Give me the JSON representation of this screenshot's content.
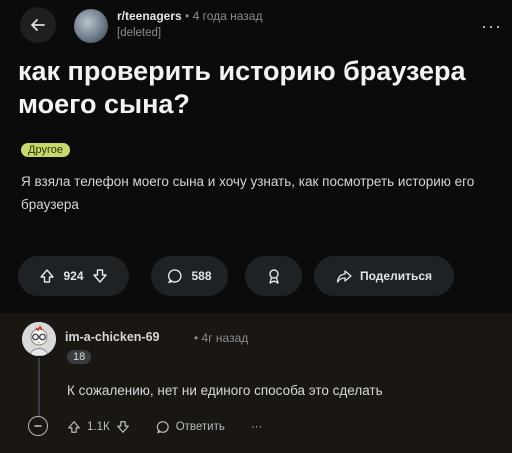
{
  "header": {
    "subreddit": "r/teenagers",
    "separator": "•",
    "time": "4 года назад",
    "author": "[deleted]"
  },
  "post": {
    "title": "как проверить историю браузера моего сына?",
    "flair": "Другое",
    "body": "Я взяла телефон моего сына и хочу узнать, как посмотреть историю его браузера"
  },
  "actions": {
    "vote_count": "924",
    "comment_count": "588",
    "share_label": "Поделиться"
  },
  "comment": {
    "author": "im-a-chicken-69",
    "separator": "•",
    "time": "4г назад",
    "badge": "18",
    "text": "К сожалению, нет ни единого способа это сделать",
    "vote_count": "1.1К",
    "reply_label": "Ответить",
    "more": "···"
  },
  "colors": {
    "background": "#0b0b0c",
    "pill": "#1f2224",
    "flair": "#c9d86d",
    "comment_background": "#1a1712"
  },
  "icons": [
    "back-arrow-icon",
    "upvote-icon",
    "downvote-icon",
    "comment-icon",
    "award-icon",
    "share-icon",
    "more-icon",
    "collapse-icon",
    "avatar"
  ]
}
